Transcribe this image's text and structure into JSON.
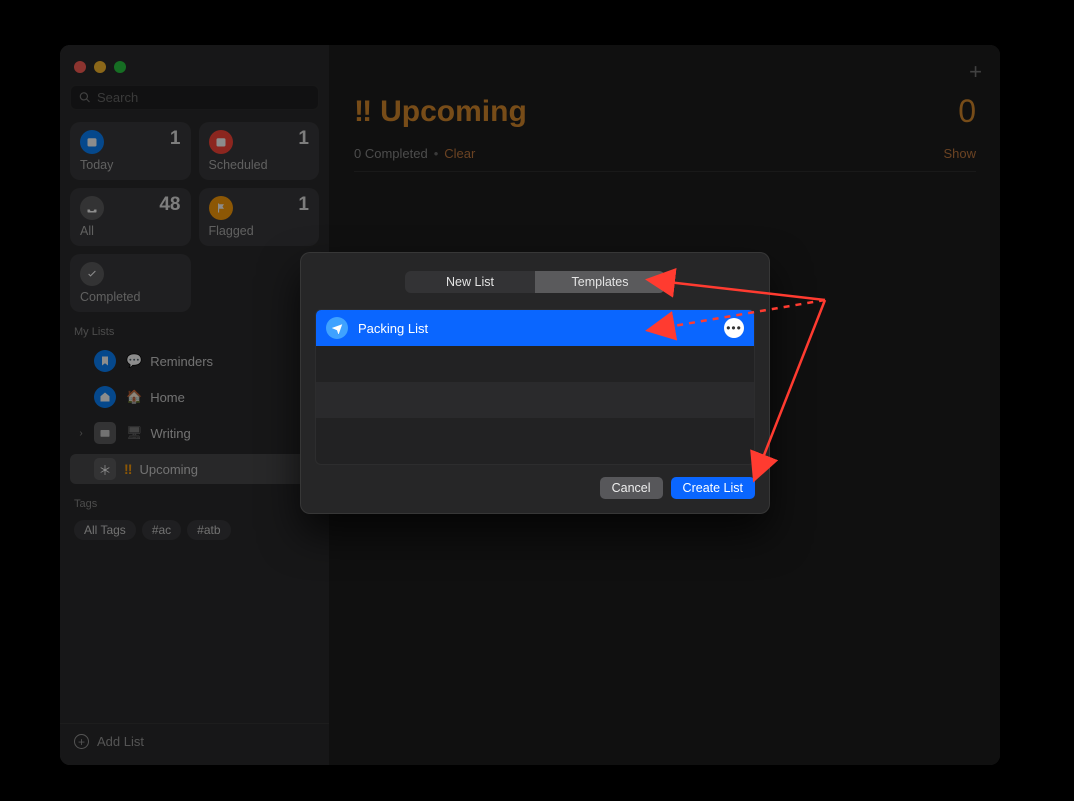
{
  "search": {
    "placeholder": "Search"
  },
  "cards": {
    "today": {
      "label": "Today",
      "count": "1"
    },
    "scheduled": {
      "label": "Scheduled",
      "count": "1"
    },
    "all": {
      "label": "All",
      "count": "48"
    },
    "flagged": {
      "label": "Flagged",
      "count": "1"
    },
    "completed": {
      "label": "Completed"
    }
  },
  "sections": {
    "mylists": "My Lists",
    "tags": "Tags"
  },
  "lists": {
    "reminders": "Reminders",
    "home": "Home",
    "writing": "Writing",
    "upcoming": "Upcoming"
  },
  "upcoming_prefix": "‼",
  "tags": {
    "all": "All Tags",
    "ac": "#ac",
    "atb": "#atb"
  },
  "add_list": "Add List",
  "main": {
    "title": "Upcoming",
    "bang": "‼",
    "count": "0",
    "completed_text": "0 Completed",
    "clear": "Clear",
    "show": "Show"
  },
  "modal": {
    "tab_newlist": "New List",
    "tab_templates": "Templates",
    "template_name": "Packing List",
    "cancel": "Cancel",
    "create": "Create List"
  }
}
